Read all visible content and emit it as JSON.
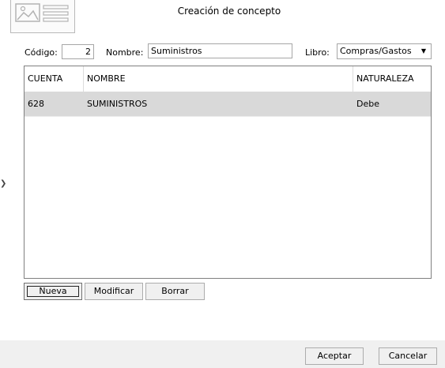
{
  "dialog": {
    "title": "Creación de concepto"
  },
  "form": {
    "codigo_label": "Código:",
    "codigo_value": "2",
    "nombre_label": "Nombre:",
    "nombre_value": "Suministros",
    "libro_label": "Libro:",
    "libro_value": "Compras/Gastos"
  },
  "grid": {
    "columns": [
      "CUENTA",
      "NOMBRE",
      "NATURALEZA"
    ],
    "rows": [
      {
        "cuenta": "628",
        "nombre": "SUMINISTROS",
        "naturaleza": "Debe"
      }
    ]
  },
  "buttons": {
    "nueva": "Nueva",
    "modificar": "Modificar",
    "borrar": "Borrar",
    "aceptar": "Aceptar",
    "cancelar": "Cancelar"
  },
  "icons": {
    "logo": "document-image-icon",
    "dropdown": "chevron-down-icon",
    "side_marker": "chevron-right-icon"
  }
}
